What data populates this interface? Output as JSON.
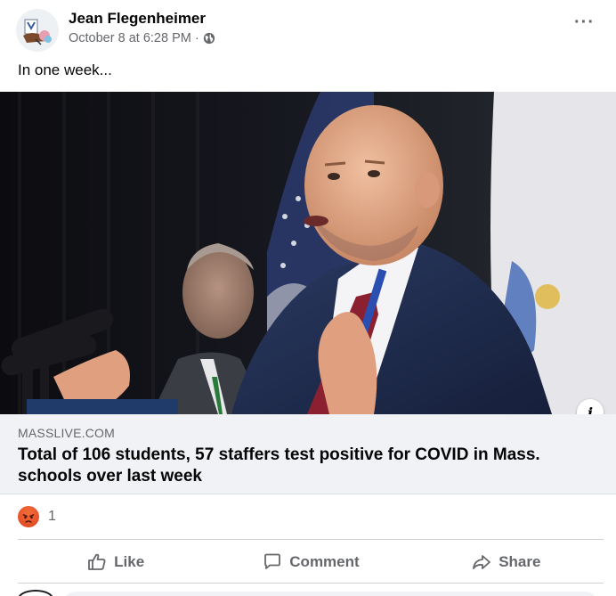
{
  "post": {
    "author": "Jean Flegenheimer",
    "date": "October 8 at 6:28 PM",
    "separator": "·",
    "text": "In one week...",
    "more_icon": "more-horizontal-icon",
    "audience_icon": "globe-icon"
  },
  "link": {
    "domain": "MASSLIVE.COM",
    "title": "Total of 106 students, 57 staffers test positive for COVID in Mass. schools over last week",
    "info_label": "i"
  },
  "reactions": {
    "type": "angry",
    "count": "1"
  },
  "actions": {
    "like": "Like",
    "comment": "Comment",
    "share": "Share"
  },
  "colors": {
    "accent_gray": "#65676b",
    "link_bg": "#f0f2f5",
    "angry": "#e8542a"
  }
}
